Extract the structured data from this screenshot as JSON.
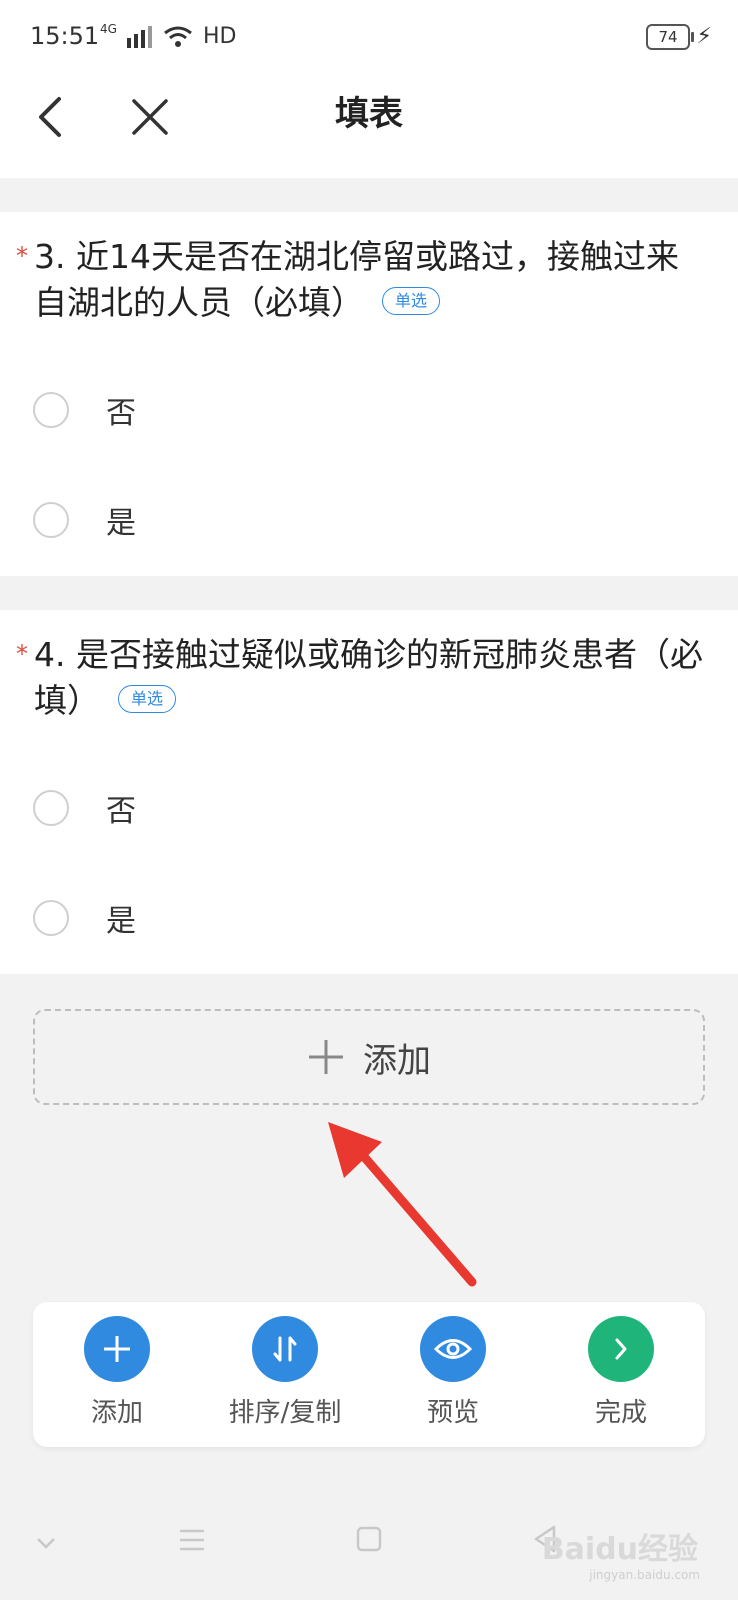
{
  "status_bar": {
    "time": "15:51",
    "network": "4G",
    "wifi_label": "HD",
    "battery": "74"
  },
  "nav": {
    "title": "填表"
  },
  "questions": [
    {
      "number_title": "3. 近14天是否在湖北停留或路过，接触过来自湖北的人员（必填）",
      "required_mark": "*",
      "tag": "单选",
      "options": [
        "否",
        "是"
      ]
    },
    {
      "number_title": "4. 是否接触过疑似或确诊的新冠肺炎患者（必填）",
      "required_mark": "*",
      "tag": "单选",
      "options": [
        "否",
        "是"
      ]
    }
  ],
  "add_box": {
    "label": "添加"
  },
  "toolbar": {
    "items": [
      {
        "label": "添加",
        "icon": "plus-icon",
        "color": "#2f8ae0"
      },
      {
        "label": "排序/复制",
        "icon": "sort-icon",
        "color": "#2f8ae0"
      },
      {
        "label": "预览",
        "icon": "eye-icon",
        "color": "#2f8ae0"
      },
      {
        "label": "完成",
        "icon": "chevron-right-icon",
        "color": "#1fb57a"
      }
    ]
  },
  "watermark": {
    "text": "Baidu经验",
    "sub": "jingyan.baidu.com"
  },
  "colors": {
    "accent": "#2f8ae0",
    "done": "#1fb57a",
    "required": "#e04a3f",
    "arrow": "#e8382f"
  }
}
